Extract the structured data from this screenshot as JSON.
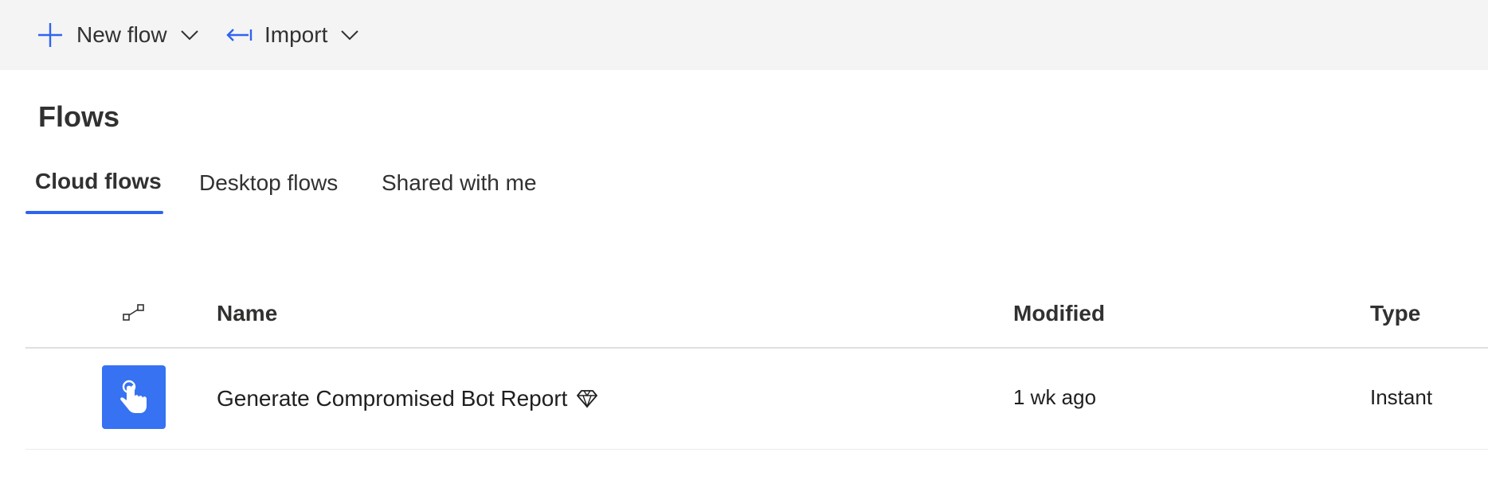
{
  "toolbar": {
    "new_flow_label": "New flow",
    "import_label": "Import"
  },
  "page": {
    "title": "Flows"
  },
  "tabs": [
    {
      "label": "Cloud flows",
      "active": true
    },
    {
      "label": "Desktop flows",
      "active": false
    },
    {
      "label": "Shared with me",
      "active": false
    }
  ],
  "table": {
    "columns": {
      "icon": "flow-type-icon",
      "name": "Name",
      "modified": "Modified",
      "type": "Type"
    },
    "rows": [
      {
        "icon": "touch-hand-icon",
        "name": "Generate Compromised Bot Report",
        "badge_icon": "premium-diamond-icon",
        "modified": "1 wk ago",
        "type": "Instant"
      }
    ]
  },
  "colors": {
    "accent": "#2f64f0",
    "flow_icon_bg": "#3672f2",
    "command_bar_bg": "#f4f4f4"
  }
}
